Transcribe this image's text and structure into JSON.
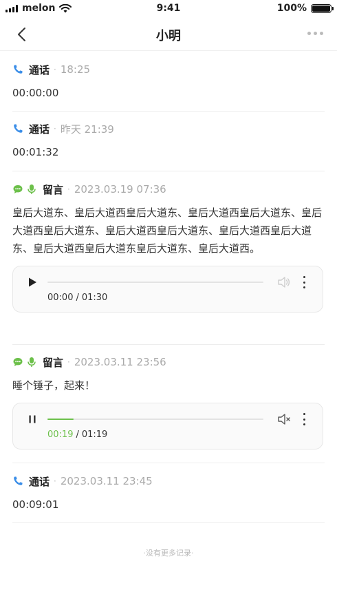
{
  "status_bar": {
    "carrier": "melon",
    "time": "9:41",
    "battery": "100%"
  },
  "nav": {
    "title": "小明"
  },
  "records": [
    {
      "type": "通话",
      "time": "18:25",
      "body": "00:00:00"
    },
    {
      "type": "通话",
      "time": "昨天 21:39",
      "body": "00:01:32"
    },
    {
      "type": "留言",
      "time": "2023.03.19 07:36",
      "body": "皇后大道东、皇后大道西皇后大道东、皇后大道西皇后大道东、皇后大道西皇后大道东、皇后大道西皇后大道东、皇后大道西皇后大道东、皇后大道西皇后大道东皇后大道东、皇后大道西。",
      "player": {
        "state": "paused",
        "current": "00:00",
        "total": "01:30",
        "progress": 0.0,
        "muted": false
      }
    },
    {
      "type": "留言",
      "time": "2023.03.11 23:56",
      "body": "睡个锤子，起来！",
      "player": {
        "state": "playing",
        "current": "00:19",
        "total": "01:19",
        "progress": 0.12,
        "muted": true
      }
    },
    {
      "type": "通话",
      "time": "2023.03.11 23:45",
      "body": "00:09:01"
    }
  ],
  "footer": {
    "text": "·没有更多记录·"
  },
  "colors": {
    "accent_green": "#6cc04a",
    "phone_blue": "#3b8ee8",
    "muted_gray": "#aaaaaa"
  },
  "icons": {
    "call": "phone-icon",
    "message": "chat-bubble-icon",
    "voice": "microphone-icon"
  }
}
